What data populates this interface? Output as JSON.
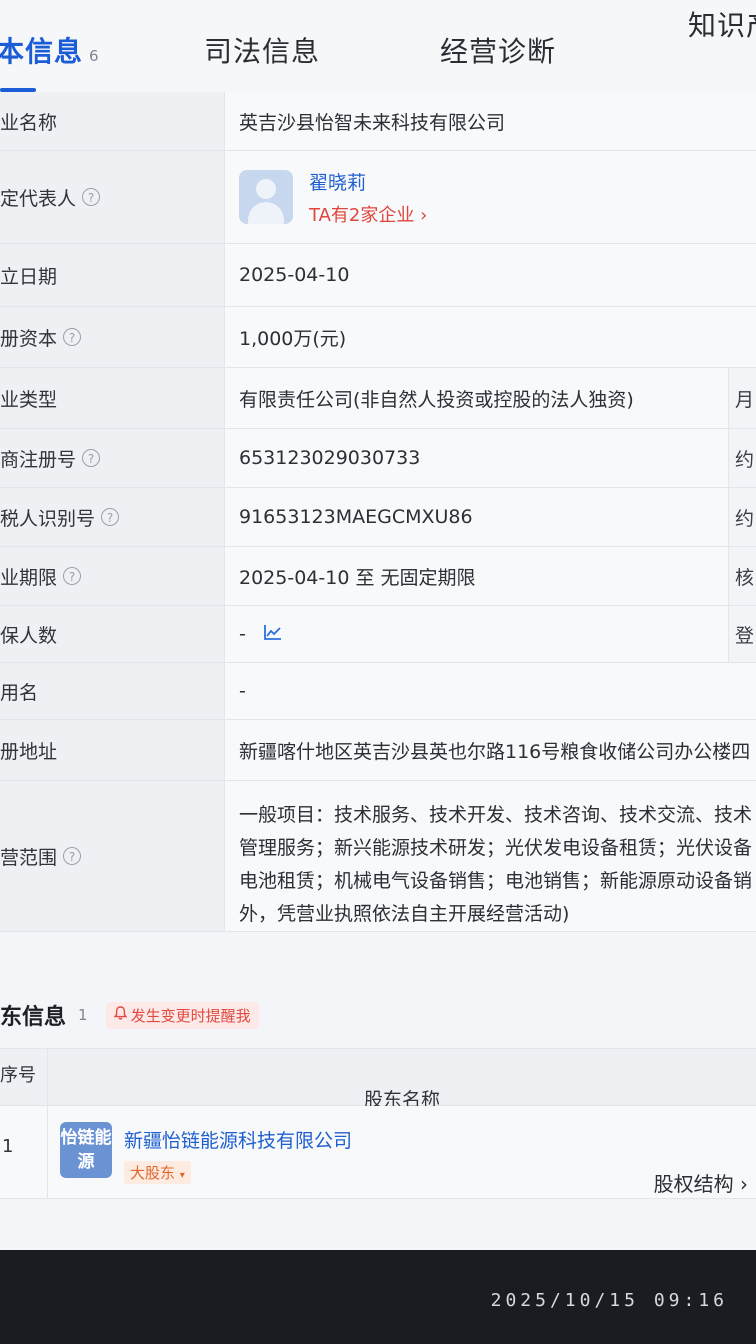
{
  "tabs": [
    {
      "label": "本信息",
      "count": "6",
      "active": true
    },
    {
      "label": "司法信息"
    },
    {
      "label": "经营诊断"
    },
    {
      "label": "知识产"
    }
  ],
  "info": {
    "company_name": {
      "label": "业名称",
      "value": "英吉沙县怡智未来科技有限公司"
    },
    "legal_rep": {
      "label": "定代表人",
      "name": "翟晓莉",
      "companies": "TA有2家企业 ›"
    },
    "established": {
      "label": "立日期",
      "value": "2025-04-10"
    },
    "capital": {
      "label": "册资本",
      "value": "1,000万(元)"
    },
    "type": {
      "label": "业类型",
      "value": "有限责任公司(非自然人投资或控股的法人独资)"
    },
    "reg_no": {
      "label": "商注册号",
      "value": "653123029030733"
    },
    "tax_id": {
      "label": "税人识别号",
      "value": "91653123MAEGCMXU86"
    },
    "term": {
      "label": "业期限",
      "value": "2025-04-10 至 无固定期限"
    },
    "insured": {
      "label": "保人数",
      "value": "-"
    },
    "former_name": {
      "label": "用名",
      "value": "-"
    },
    "address": {
      "label": "册地址",
      "value": "新疆喀什地区英吉沙县英也尔路116号粮食收储公司办公楼四"
    },
    "scope": {
      "label": "营范围",
      "lines": [
        "一般项目：技术服务、技术开发、技术咨询、技术交流、技术",
        "管理服务；新兴能源技术研发；光伏发电设备租赁；光伏设备",
        "电池租赁；机械电气设备销售；电池销售；新能源原动设备销",
        "外，凭营业执照依法自主开展经营活动)"
      ]
    }
  },
  "right_edge": [
    "",
    "",
    "",
    "",
    "",
    "月",
    "约",
    "约",
    "核",
    "登"
  ],
  "shareholders": {
    "title": "东信息",
    "count": "1",
    "remind_label": "发生变更时提醒我",
    "col_index": "序号",
    "col_name": "股东名称",
    "rows": [
      {
        "index": "1",
        "logo_text": "怡链能源",
        "name": "新疆怡链能源科技有限公司",
        "tag": "大股东",
        "link": "股权结构 ›"
      }
    ]
  },
  "timestamp": "2025/10/15 09:16",
  "colors": {
    "accent": "#1b5cd7",
    "link": "#1f5fcf",
    "alert": "#e0463c",
    "logo_bg": "#6b93d3"
  },
  "icons": [
    "help-icon",
    "avatar-placeholder-icon",
    "trend-chart-icon",
    "bell-icon",
    "chevron-right-icon",
    "caret-down-icon"
  ]
}
